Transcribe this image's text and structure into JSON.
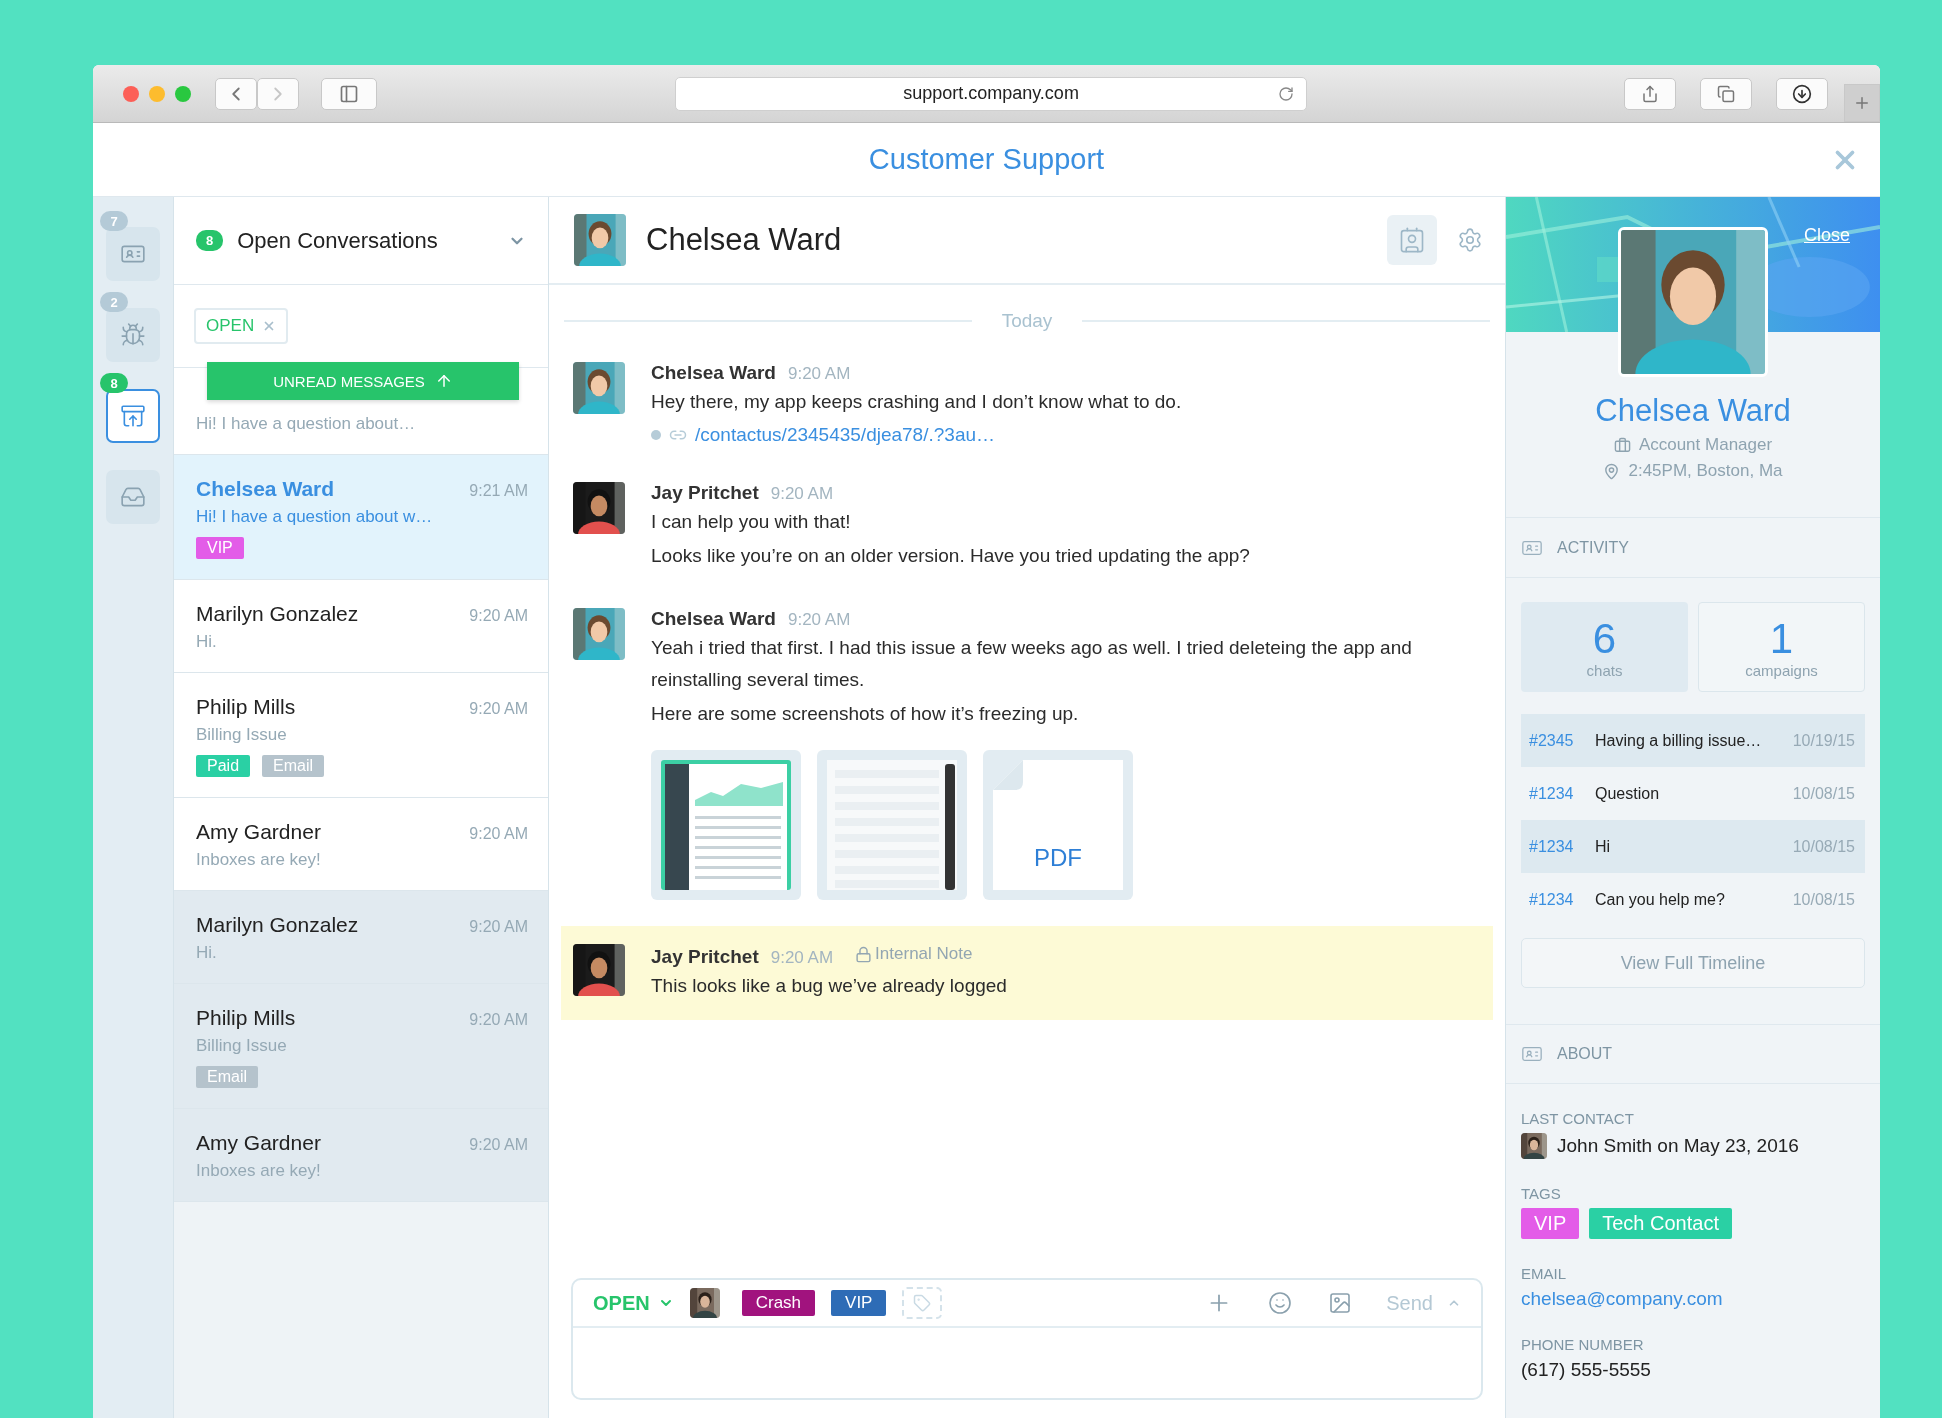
{
  "browser": {
    "url": "support.company.com"
  },
  "app": {
    "title": "Customer Support"
  },
  "rail": [
    {
      "kind": "badge",
      "count": "7",
      "selected": false
    },
    {
      "kind": "bug",
      "count": "2",
      "selected": false
    },
    {
      "kind": "inbox",
      "count": "8",
      "selected": true
    },
    {
      "kind": "tray",
      "selected": false
    }
  ],
  "list": {
    "count": "8",
    "title": "Open Conversations",
    "filter": "OPEN",
    "banner": "UNREAD MESSAGES",
    "conversations": [
      {
        "preview": "Hi! I have a question about…",
        "selected": false,
        "unread": true
      },
      {
        "name": "Chelsea Ward",
        "time": "9:21 AM",
        "preview": "Hi! I have a question about w…",
        "selected": true,
        "unread": true,
        "tags": [
          {
            "label": "VIP",
            "color": "#e35ce8"
          }
        ]
      },
      {
        "name": "Marilyn Gonzalez",
        "time": "9:20 AM",
        "preview": "Hi.",
        "selected": false,
        "unread": true
      },
      {
        "name": "Philip Mills",
        "time": "9:20 AM",
        "preview": "Billing Issue",
        "selected": false,
        "unread": true,
        "tags": [
          {
            "label": "Paid",
            "color": "#2ad0a4"
          },
          {
            "label": "Email",
            "color": "#b5c3cc"
          }
        ]
      },
      {
        "name": "Amy Gardner",
        "time": "9:20 AM",
        "preview": "Inboxes are key!",
        "selected": false,
        "unread": true
      },
      {
        "name": "Marilyn Gonzalez",
        "time": "9:20 AM",
        "preview": "Hi.",
        "selected": false,
        "unread": false
      },
      {
        "name": "Philip Mills",
        "time": "9:20 AM",
        "preview": "Billing Issue",
        "selected": false,
        "unread": false,
        "tags": [
          {
            "label": "Email",
            "color": "#b5c3cc"
          }
        ]
      },
      {
        "name": "Amy Gardner",
        "time": "9:20 AM",
        "preview": "Inboxes are key!",
        "selected": false,
        "unread": false
      }
    ]
  },
  "chat": {
    "contact": "Chelsea Ward",
    "divider": "Today",
    "messages": [
      {
        "kind": "message",
        "author": "Chelsea Ward",
        "time": "9:20 AM",
        "lines": [
          "Hey there, my app keeps crashing and I don’t know what to do."
        ],
        "link": "/contactus/2345435/djea78/.?3au…"
      },
      {
        "kind": "message",
        "author": "Jay Pritchet",
        "time": "9:20 AM",
        "lines": [
          "I can help you with that!",
          "Looks like you’re on an older version. Have you tried updating the app?"
        ]
      },
      {
        "kind": "message",
        "author": "Chelsea Ward",
        "time": "9:20 AM",
        "lines": [
          "Yeah i tried that first. I had this issue a few weeks ago as well. I tried deleteing the app and reinstalling several times.",
          "Here are some screenshots of how it’s freezing up."
        ],
        "attachments": [
          {
            "kind": "dashboard"
          },
          {
            "kind": "form"
          },
          {
            "kind": "file",
            "label": "PDF"
          }
        ]
      },
      {
        "kind": "note",
        "author": "Jay Pritchet",
        "time": "9:20 AM",
        "note_label": "Internal Note",
        "lines": [
          "This looks like a bug we’ve already logged"
        ]
      }
    ],
    "composer": {
      "status": "OPEN",
      "tags": [
        {
          "label": "Crash",
          "color": "#a1137e"
        },
        {
          "label": "VIP",
          "color": "#2e6cb6"
        }
      ],
      "send": "Send"
    }
  },
  "profile": {
    "close": "Close",
    "name": "Chelsea Ward",
    "role": "Account Manager",
    "location": "2:45PM, Boston, Ma",
    "activity": {
      "title": "ACTIVITY",
      "stats": [
        {
          "value": "6",
          "label": "chats",
          "selected": true
        },
        {
          "value": "1",
          "label": "campaigns",
          "selected": false
        }
      ],
      "tickets": [
        {
          "id": "#2345",
          "subject": "Having a billing issue…",
          "date": "10/19/15"
        },
        {
          "id": "#1234",
          "subject": "Question",
          "date": "10/08/15"
        },
        {
          "id": "#1234",
          "subject": "Hi",
          "date": "10/08/15"
        },
        {
          "id": "#1234",
          "subject": "Can you help me?",
          "date": "10/08/15"
        }
      ],
      "button": "View Full Timeline"
    },
    "about": {
      "title": "ABOUT",
      "fields": [
        {
          "kind": "contact",
          "label": "LAST CONTACT",
          "value": "John Smith on May 23, 2016"
        },
        {
          "kind": "tags",
          "label": "TAGS",
          "tags": [
            {
              "label": "VIP",
              "color": "#e35ce8"
            },
            {
              "label": "Tech Contact",
              "color": "#2ad0a4"
            }
          ]
        },
        {
          "kind": "email",
          "label": "EMAIL",
          "value": "chelsea@company.com"
        },
        {
          "kind": "text",
          "label": "PHONE NUMBER",
          "value": "(617) 555-5555"
        }
      ]
    }
  }
}
